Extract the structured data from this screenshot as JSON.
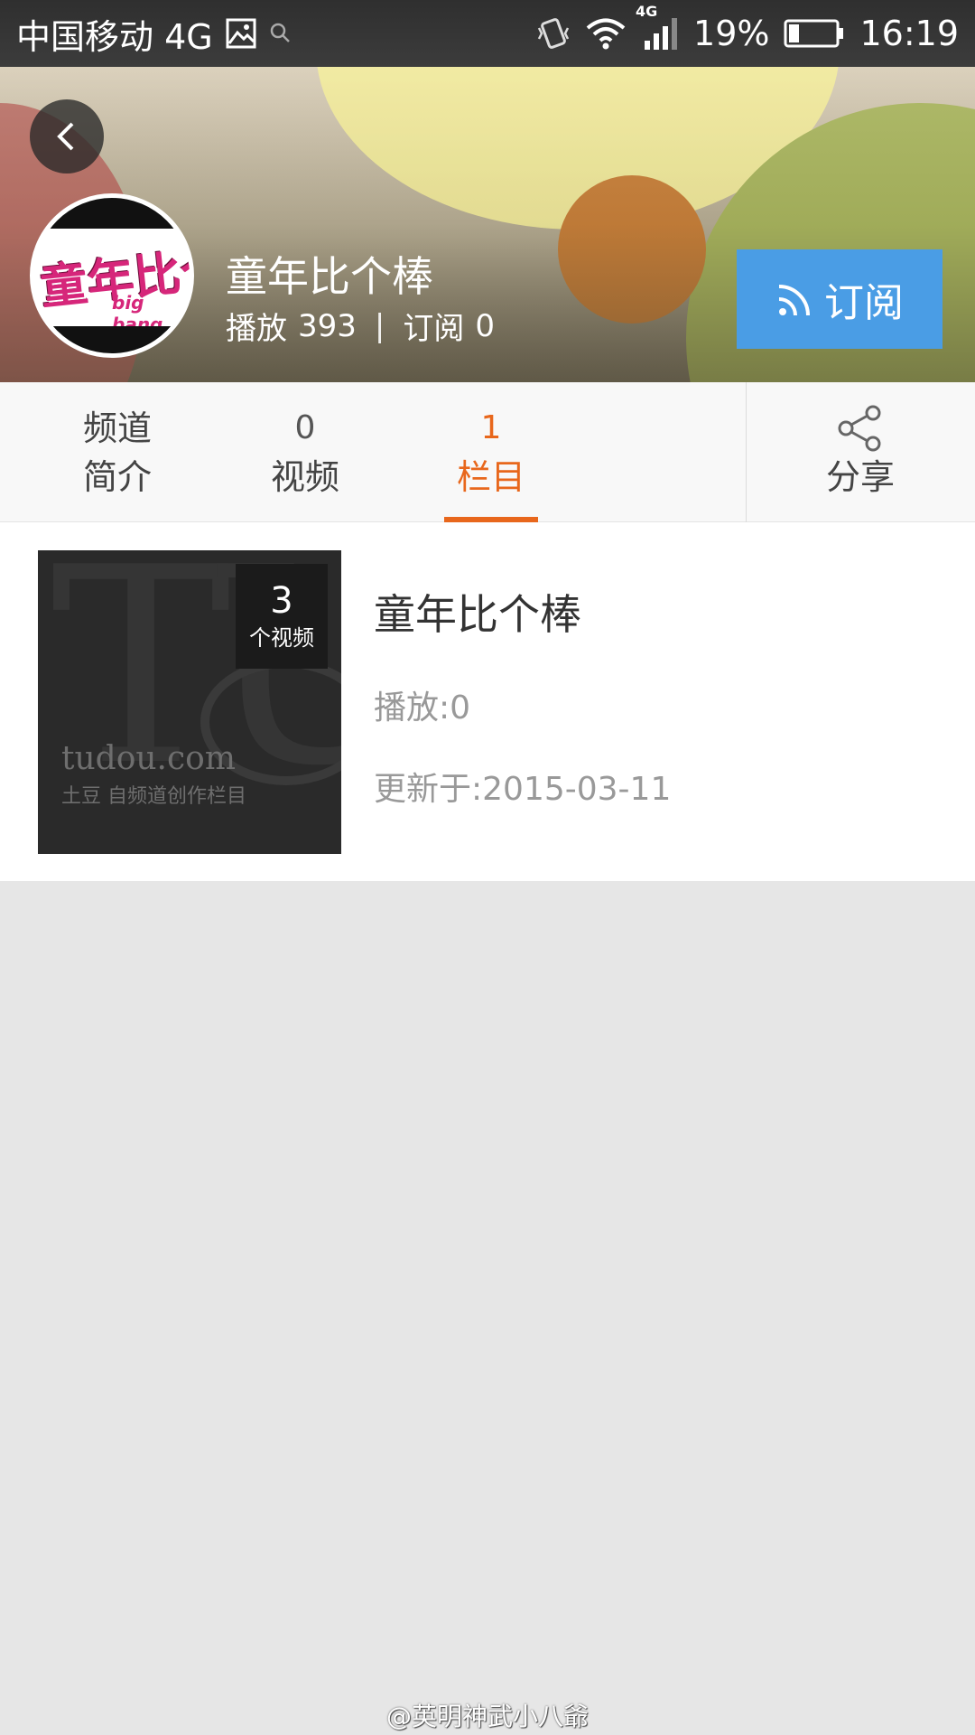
{
  "status_bar": {
    "carrier": "中国移动 4G",
    "network_badge": "4G",
    "battery_percent": "19%",
    "time": "16:19",
    "icons": [
      "gallery-icon",
      "search-icon",
      "vibrate-icon",
      "wifi-icon",
      "signal-icon",
      "battery-icon"
    ]
  },
  "channel": {
    "title": "童年比个棒",
    "plays_label": "播放",
    "plays_value": "393",
    "separator": "|",
    "subs_label": "订阅",
    "subs_value": "0",
    "subscribe_button": "订阅",
    "avatar_logo_text": "童年比个棒",
    "avatar_logo_sub": "big bang"
  },
  "tabs": {
    "intro_line1": "频道",
    "intro_line2": "简介",
    "videos_count": "0",
    "videos_label": "视频",
    "columns_count": "1",
    "columns_label": "栏目",
    "share_label": "分享",
    "active_tab": "栏目",
    "accent_color": "#e8671c"
  },
  "column_list": [
    {
      "thumb_brand": "tudou.com",
      "thumb_sub": "土豆 自频道创作栏目",
      "video_count": "3",
      "video_count_unit": "个视频",
      "title": "童年比个棒",
      "plays": "播放:0",
      "updated": "更新于:2015-03-11"
    }
  ],
  "watermark": "@英明神武小八爺",
  "colors": {
    "subscribe_button_bg": "#4a9de5",
    "page_bg": "#e6e6e6"
  }
}
